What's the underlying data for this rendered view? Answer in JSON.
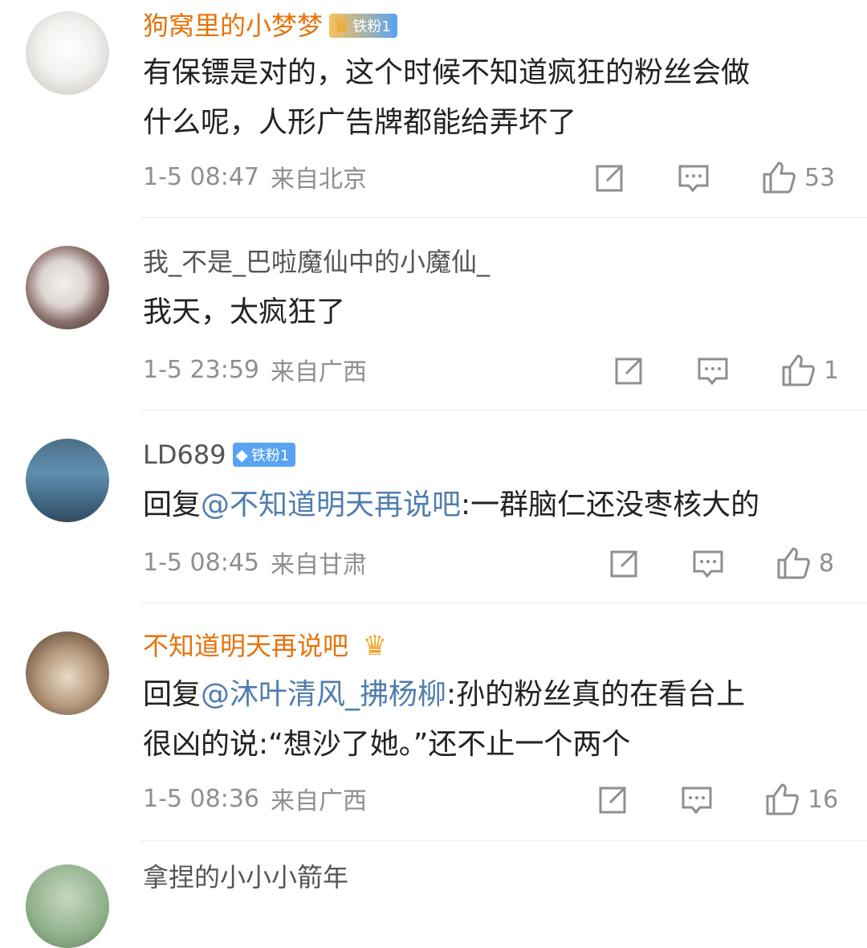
{
  "comments": [
    {
      "username": "狗窝里的小梦梦",
      "badge": "铁粉1",
      "text_lines": [
        "有保镖是对的，这个时候不知道疯狂的粉丝会做",
        "什么呢，人形广告牌都能给弄坏了"
      ],
      "time": "1-5 08:47",
      "location": "来自北京",
      "likes": "53"
    },
    {
      "username": "我_不是_巴啦魔仙中的小魔仙_",
      "text_lines": [
        "我天，太疯狂了"
      ],
      "time": "1-5 23:59",
      "location": "来自广西",
      "likes": "1"
    },
    {
      "username": "LD689",
      "badge": "铁粉1",
      "reply_prefix": "回复",
      "mention": "@不知道明天再说吧",
      "reply_text": ":一群脑仁还没枣核大的",
      "time": "1-5 08:45",
      "location": "来自甘肃",
      "likes": "8"
    },
    {
      "username": "不知道明天再说吧",
      "reply_prefix": "回复",
      "mention": "@沐叶清风_拂杨柳",
      "reply_text": ":孙的粉丝真的在看台上",
      "text_line2": "很凶的说:“想沙了她。”还不止一个两个",
      "time": "1-5 08:36",
      "location": "来自广西",
      "likes": "16"
    }
  ],
  "partial_next_username": "拿捏的小小小箭年",
  "icons": {
    "share": "share-icon",
    "comment": "comment-icon",
    "like": "thumbs-up-icon",
    "crown": "crown-icon",
    "diamond": "diamond-icon"
  },
  "colors": {
    "username_orange": "#e8720c",
    "username_gray": "#555555",
    "mention_blue": "#507daf",
    "meta_gray": "#8f8f8f"
  }
}
